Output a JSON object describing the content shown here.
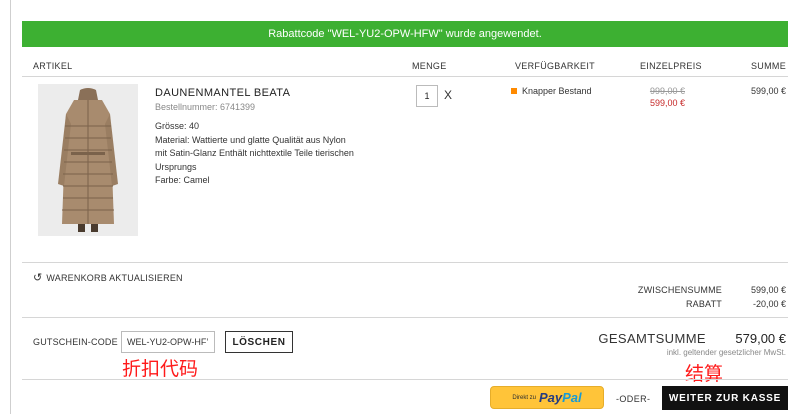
{
  "banner": {
    "text": "Rabattcode \"WEL-YU2-OPW-HFW\" wurde angewendet."
  },
  "table_headers": {
    "artikel": "ARTIKEL",
    "menge": "MENGE",
    "verfuegbarkeit": "VERFÜGBARKEIT",
    "einzelpreis": "EINZELPREIS",
    "summe": "SUMME"
  },
  "item": {
    "name": "DAUNENMANTEL BEATA",
    "order_number": "Bestellnummer: 6741399",
    "details": [
      "Grösse: 40",
      "Material: Wattierte und glatte Qualität aus Nylon",
      "mit Satin-Glanz Enthält nichttextile Teile tierischen",
      "Ursprungs",
      "Farbe: Camel"
    ],
    "quantity": "1",
    "remove_glyph": "X",
    "availability": "Knapper Bestand",
    "availability_color": "#ff8a00",
    "old_price": "999,00 €",
    "new_price": "599,00 €",
    "sum": "599,00 €",
    "image_icon": "camel-down-coat-image"
  },
  "update_cart": {
    "icon": "refresh-icon",
    "glyph": "↺",
    "label": "WARENKORB AKTUALISIEREN"
  },
  "totals": {
    "subtotal_label": "ZWISCHENSUMME",
    "subtotal_value": "599,00 €",
    "discount_label": "RABATT",
    "discount_value": "-20,00 €",
    "total_label": "GESAMTSUMME",
    "total_value": "579,00 €",
    "vat_note": "inkl. geltender gesetzlicher MwSt."
  },
  "coupon": {
    "label": "GUTSCHEIN-CODE",
    "value": "WEL-YU2-OPW-HF’",
    "delete_label": "LÖSCHEN"
  },
  "annotations": {
    "coupon": "折扣代码",
    "checkout": "结算"
  },
  "paypal": {
    "prefix": "Direkt zu",
    "brand_part1": "Pay",
    "brand_part2": "Pal"
  },
  "oder": "-ODER-",
  "checkout_label": "WEITER ZUR KASSE",
  "colors": {
    "accent_green": "#3db032",
    "sale_red": "#c62828",
    "paypal_yellow": "#ffc439",
    "annotation_red": "#ff1a1a"
  }
}
